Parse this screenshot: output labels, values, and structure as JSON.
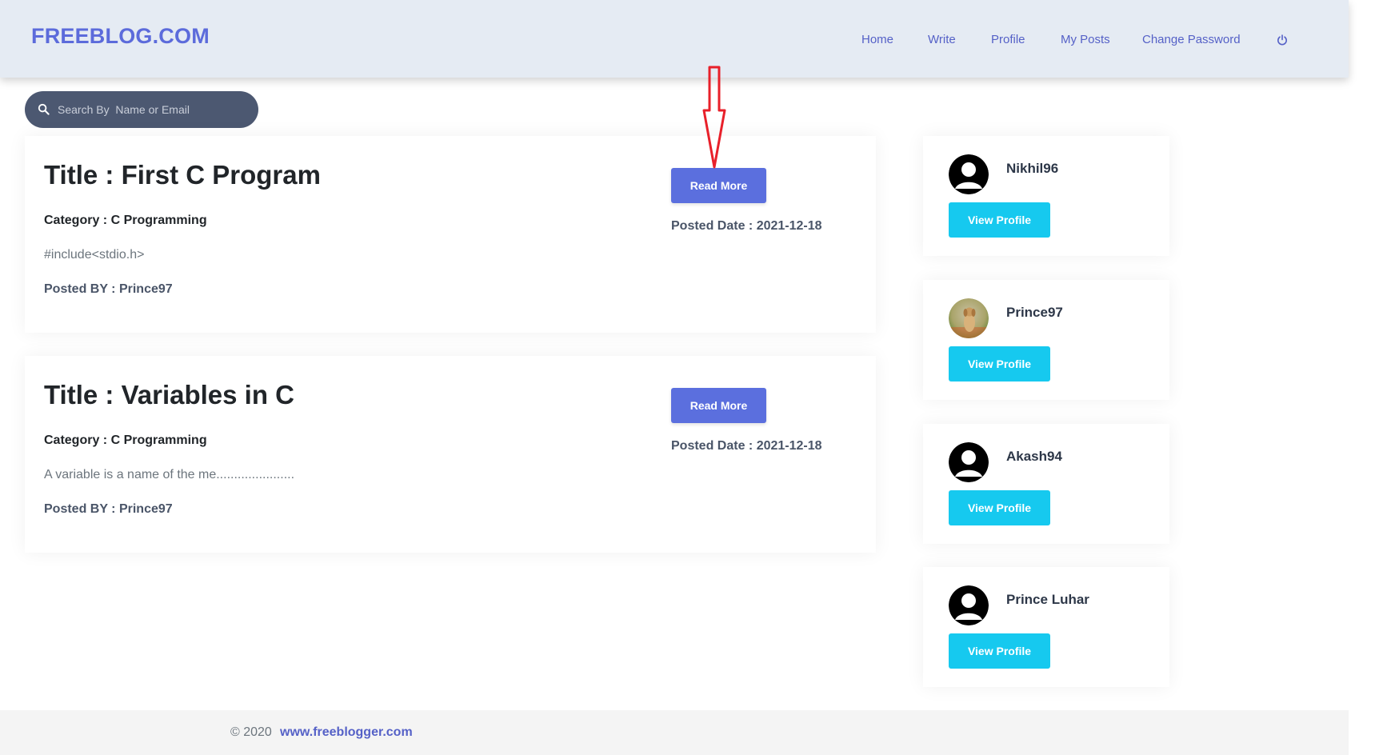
{
  "brand": "FREEBLOG.COM",
  "nav": {
    "items": [
      {
        "label": "Home"
      },
      {
        "label": "Write"
      },
      {
        "label": "Profile"
      },
      {
        "label": "My Posts"
      },
      {
        "label": "Change Password"
      }
    ],
    "logout_icon": "power-icon"
  },
  "search": {
    "placeholder": "Search By  Name or Email",
    "value": "",
    "icon": "search-icon"
  },
  "posts": [
    {
      "title": "Title : First C Program",
      "category": "Category : C Programming",
      "excerpt": "#include<stdio.h>",
      "author": "Posted BY : Prince97",
      "read_more": "Read More",
      "date": "Posted Date : 2021-12-18"
    },
    {
      "title": "Title : Variables in C",
      "category": "Category : C Programming",
      "excerpt": "A variable is a name of the me......................",
      "author": "Posted BY : Prince97",
      "read_more": "Read More",
      "date": "Posted Date : 2021-12-18"
    }
  ],
  "users": [
    {
      "name": "Nikhil96",
      "button": "View Profile",
      "avatar": "default-avatar-icon"
    },
    {
      "name": "Prince97",
      "button": "View Profile",
      "avatar": "dog-photo"
    },
    {
      "name": "Akash94",
      "button": "View Profile",
      "avatar": "default-avatar-icon"
    },
    {
      "name": "Prince Luhar",
      "button": "View Profile",
      "avatar": "default-avatar-icon"
    }
  ],
  "footer": {
    "copyright": "© 2020",
    "link": "www.freeblogger.com"
  },
  "colors": {
    "brand": "#5c6bdb",
    "header_bg": "#e5ebf3",
    "read_more_bg": "#5b6fde",
    "view_profile_bg": "#16c9ef",
    "search_bg": "#4c5871",
    "annotation": "#e8202a"
  }
}
